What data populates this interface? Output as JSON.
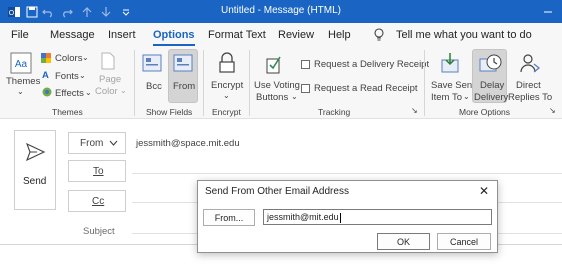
{
  "titlebar": {
    "title": "Untitled  -  Message (HTML)",
    "bg_color": "#1a64c4",
    "icons": [
      "outlook-icon",
      "save-icon",
      "undo-icon",
      "redo-icon",
      "up-arrow-icon",
      "down-arrow-icon",
      "customize-icon",
      "minimize-icon"
    ]
  },
  "tabs": [
    "File",
    "Message",
    "Insert",
    "Options",
    "Format Text",
    "Review",
    "Help"
  ],
  "active_tab": "Options",
  "tell_me": "Tell me what you want to do",
  "ribbon": {
    "themes": {
      "label": "Themes",
      "colors": "Colors",
      "fonts": "Fonts",
      "effects": "Effects",
      "page_color": "Page",
      "page_color2": "Color",
      "group": "Themes"
    },
    "show_fields": {
      "bcc": "Bcc",
      "from": "From",
      "group": "Show Fields"
    },
    "encrypt": {
      "label": "Encrypt",
      "group": "Encrypt"
    },
    "tracking": {
      "voting": "Use Voting",
      "voting2": "Buttons",
      "delivery": "Request a Delivery Receipt",
      "read": "Request a Read Receipt",
      "group": "Tracking"
    },
    "more": {
      "save_sent": "Save Sent",
      "save_sent2": "Item To",
      "delay": "Delay",
      "delay2": "Delivery",
      "direct": "Direct",
      "direct2": "Replies To",
      "group": "More Options"
    }
  },
  "compose": {
    "send": "Send",
    "from_btn": "From",
    "to_btn": "To",
    "cc_btn": "Cc",
    "subject": "Subject",
    "from_value": "jessmith@space.mit.edu"
  },
  "dialog": {
    "title": "Send From Other Email Address",
    "from_btn": "From...",
    "input_value": "jessmith@mit.edu",
    "ok": "OK",
    "cancel": "Cancel"
  }
}
